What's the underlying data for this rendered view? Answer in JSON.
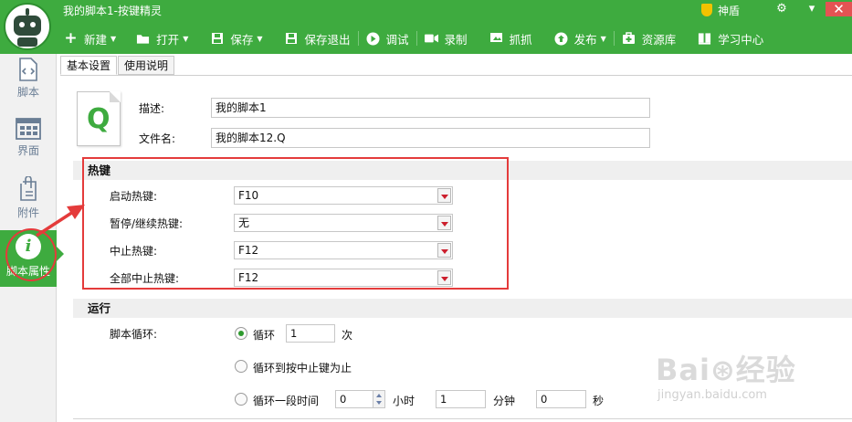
{
  "colors": {
    "brand_green": "#3eab3f",
    "annotation_red": "#e43b3b",
    "dropdown_arrow": "#cc1f2d"
  },
  "window": {
    "title": "我的脚本1-按键精灵",
    "shield_label": "神盾"
  },
  "toolbar": {
    "items": [
      {
        "label": "新建",
        "icon": "plus-icon"
      },
      {
        "label": "打开",
        "icon": "folder-icon"
      },
      {
        "label": "保存",
        "icon": "save-icon"
      },
      {
        "label": "保存退出",
        "icon": "save-exit-icon"
      },
      {
        "label": "调试",
        "icon": "play-icon"
      },
      {
        "label": "录制",
        "icon": "camcorder-icon"
      },
      {
        "label": "抓抓",
        "icon": "screen-capture-icon"
      },
      {
        "label": "发布",
        "icon": "publish-icon"
      },
      {
        "label": "资源库",
        "icon": "resource-library-icon"
      },
      {
        "label": "学习中心",
        "icon": "learning-center-icon"
      }
    ]
  },
  "sidebar": {
    "items": [
      {
        "label": "脚本",
        "icon": "script-file-icon"
      },
      {
        "label": "界面",
        "icon": "interface-grid-icon"
      },
      {
        "label": "附件",
        "icon": "paperclip-icon"
      },
      {
        "label": "脚本属性",
        "icon": "info-icon"
      }
    ]
  },
  "tabs": [
    {
      "label": "基本设置"
    },
    {
      "label": "使用说明"
    }
  ],
  "basic": {
    "file_icon_letter": "Q",
    "desc_label": "描述:",
    "desc_value": "我的脚本1",
    "filename_label": "文件名:",
    "filename_value": "我的脚本12.Q"
  },
  "hotkeys": {
    "title": "热键",
    "rows": [
      {
        "label": "启动热键:",
        "value": "F10"
      },
      {
        "label": "暂停/继续热键:",
        "value": "无"
      },
      {
        "label": "中止热键:",
        "value": "F12"
      },
      {
        "label": "全部中止热键:",
        "value": "F12"
      }
    ]
  },
  "run": {
    "title": "运行",
    "loop_label": "脚本循环:",
    "opt_loop": "循环",
    "loop_count": "1",
    "unit_times": "次",
    "opt_until_stop": "循环到按中止键为止",
    "opt_duration": "循环一段时间",
    "hours": "0",
    "unit_hours": "小时",
    "minutes": "1",
    "unit_minutes": "分钟",
    "seconds": "0",
    "unit_seconds": "秒"
  },
  "watermark": {
    "logo": "Bai⊛经验",
    "url": "jingyan.baidu.com"
  }
}
